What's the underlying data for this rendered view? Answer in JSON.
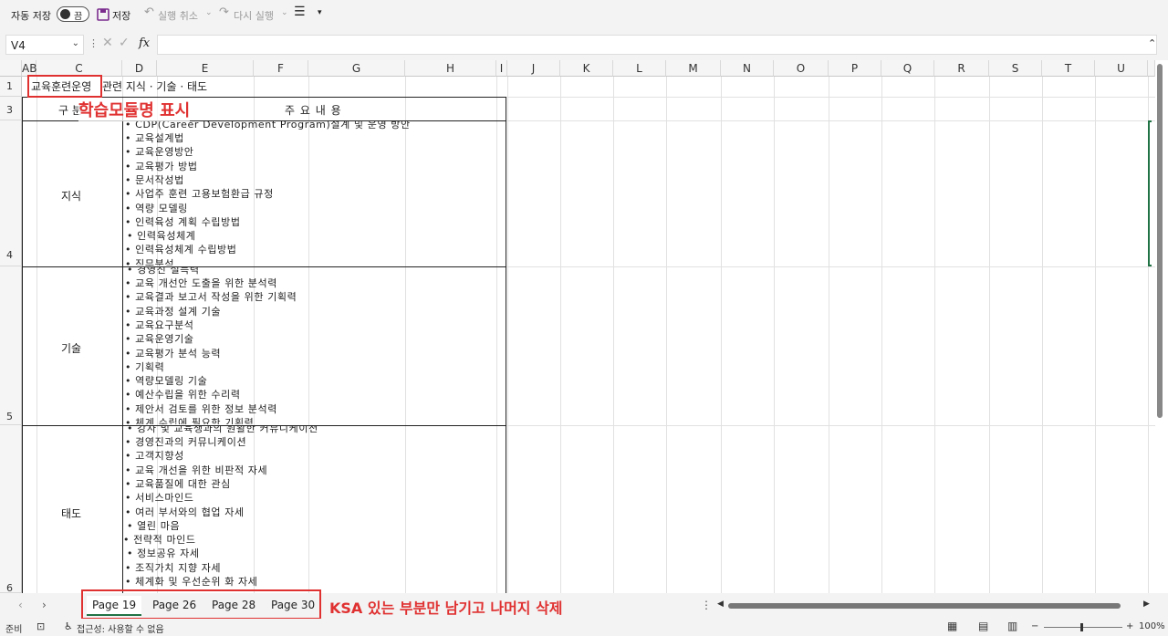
{
  "toolbar": {
    "autosave_label": "자동 저장",
    "autosave_state": "끔",
    "save_label": "저장",
    "undo_label": "실행 취소",
    "redo_label": "다시 실행"
  },
  "formula_bar": {
    "name_box": "V4",
    "fx_label": "fx",
    "formula_value": ""
  },
  "columns": [
    "AB",
    "C",
    "D",
    "E",
    "F",
    "G",
    "H",
    "I",
    "J",
    "K",
    "L",
    "M",
    "N",
    "O",
    "P",
    "Q",
    "R",
    "S",
    "T",
    "U"
  ],
  "rows": [
    "1",
    "3",
    "4",
    "5",
    "6"
  ],
  "sheet": {
    "title_prefix": "교육훈련운영",
    "title_suffix": "관련 지식 · 기술 · 태도",
    "header_category": "구 분",
    "header_content": "주 요 내 용",
    "sections": [
      {
        "category": "지식",
        "items": [
          "• CDP(Career Development Program)설계 및 운영 방안",
          "• 교육설계법",
          "• 교육운영방안",
          "• 교육평가 방법",
          "• 문서작성법",
          "• 사업주 훈련 고용보험환급 규정",
          "• 역량 모델링",
          "• 인력육성 계획 수립방법",
          "• 인력육성체계",
          "• 인력육성체계 수립방법",
          "• 직무분석"
        ]
      },
      {
        "category": "기술",
        "items": [
          "• 경영진 설득력",
          "• 교육 개선안 도출을 위한 분석력",
          "• 교육결과 보고서 작성을 위한 기획력",
          "• 교육과정 설계 기술",
          "• 교육요구분석",
          "• 교육운영기술",
          "• 교육평가 분석 능력",
          "• 기획력",
          "• 역량모델링 기술",
          "• 예산수립을 위한 수리력",
          "• 제안서 검토를 위한 정보 분석력",
          "• 체계 수립에 필요한 기획력"
        ]
      },
      {
        "category": "태도",
        "items": [
          "• 강사 및 교육생과의 원활한 커뮤니케이션",
          "• 경영진과의 커뮤니케이션",
          "• 고객지향성",
          "• 교육 개선을 위한 비판적 자세",
          "• 교육품질에 대한 관심",
          "• 서비스마인드",
          "• 여러 부서와의 협업 자세",
          "• 열린 마음",
          "• 전략적 마인드",
          "• 정보공유 자세",
          "• 조직가치 지향 자세",
          "• 체계화 및 우선순위 화 자세"
        ]
      }
    ]
  },
  "annotations": {
    "module_note": "학습모듈명 표시",
    "tabs_note": "KSA 있는 부분만 남기고 나머지 삭제"
  },
  "sheet_tabs": [
    "Page 19",
    "Page 26",
    "Page 28",
    "Page 30"
  ],
  "status_bar": {
    "ready": "준비",
    "accessibility": "접근성: 사용할 수 없음",
    "zoom": "100%"
  },
  "colors": {
    "annotation_red": "#e03131",
    "active_tab_accent": "#217346"
  }
}
